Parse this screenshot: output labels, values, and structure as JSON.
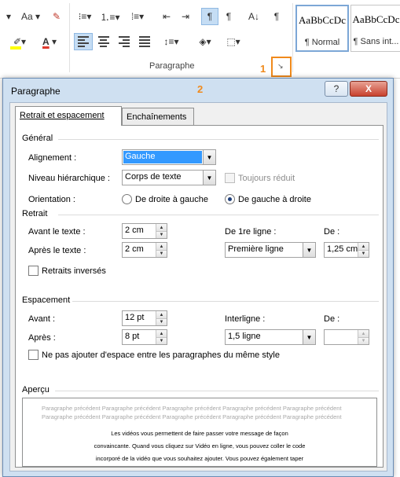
{
  "ribbon": {
    "group_label": "Paragraphe",
    "marker_1": "1",
    "marker_2": "2",
    "styles": [
      {
        "sample": "AaBbCcDc",
        "name": "¶ Normal"
      },
      {
        "sample": "AaBbCcDc",
        "name": "¶ Sans int..."
      }
    ],
    "font_size_label": "Aa",
    "pilcrow": "¶"
  },
  "dialog": {
    "title": "Paragraphe",
    "help_label": "?",
    "close_label": "X",
    "tabs": [
      {
        "label": "Retrait et espacement"
      },
      {
        "label": "Enchaînements"
      }
    ],
    "general": {
      "heading": "Général",
      "alignment_label": "Alignement :",
      "alignment_value": "Gauche",
      "outline_label": "Niveau hiérarchique :",
      "outline_value": "Corps de texte",
      "collapsed_label": "Toujours réduit",
      "orientation_label": "Orientation :",
      "rtl_label": "De droite à gauche",
      "ltr_label": "De gauche à droite"
    },
    "indent": {
      "heading": "Retrait",
      "before_label": "Avant le texte :",
      "before_value": "2 cm",
      "after_label": "Après le texte :",
      "after_value": "2 cm",
      "first_line_label": "De 1re ligne :",
      "first_line_value": "Première ligne",
      "by_label": "De :",
      "by_value": "1,25 cm",
      "mirror_label": "Retraits inversés"
    },
    "spacing": {
      "heading": "Espacement",
      "before_label": "Avant :",
      "before_value": "12 pt",
      "after_label": "Après :",
      "after_value": "8 pt",
      "line_label": "Interligne :",
      "line_value": "1,5 ligne",
      "at_label": "De :",
      "at_value": "",
      "no_space_label": "Ne pas ajouter d'espace entre les paragraphes du même style"
    },
    "preview": {
      "heading": "Aperçu",
      "previous_lines": [
        "Paragraphe précédent Paragraphe précédent Paragraphe précédent Paragraphe précédent Paragraphe précédent",
        "Paragraphe précédent Paragraphe précédent Paragraphe précédent Paragraphe précédent Paragraphe précédent"
      ],
      "current_lines": [
        "Les vidéos vous permettent de faire passer votre message de façon",
        "convaincante. Quand vous cliquez sur Vidéo en ligne, vous pouvez coller le code",
        "incorporé de la vidéo que vous souhaitez ajouter. Vous pouvez également taper"
      ]
    }
  }
}
